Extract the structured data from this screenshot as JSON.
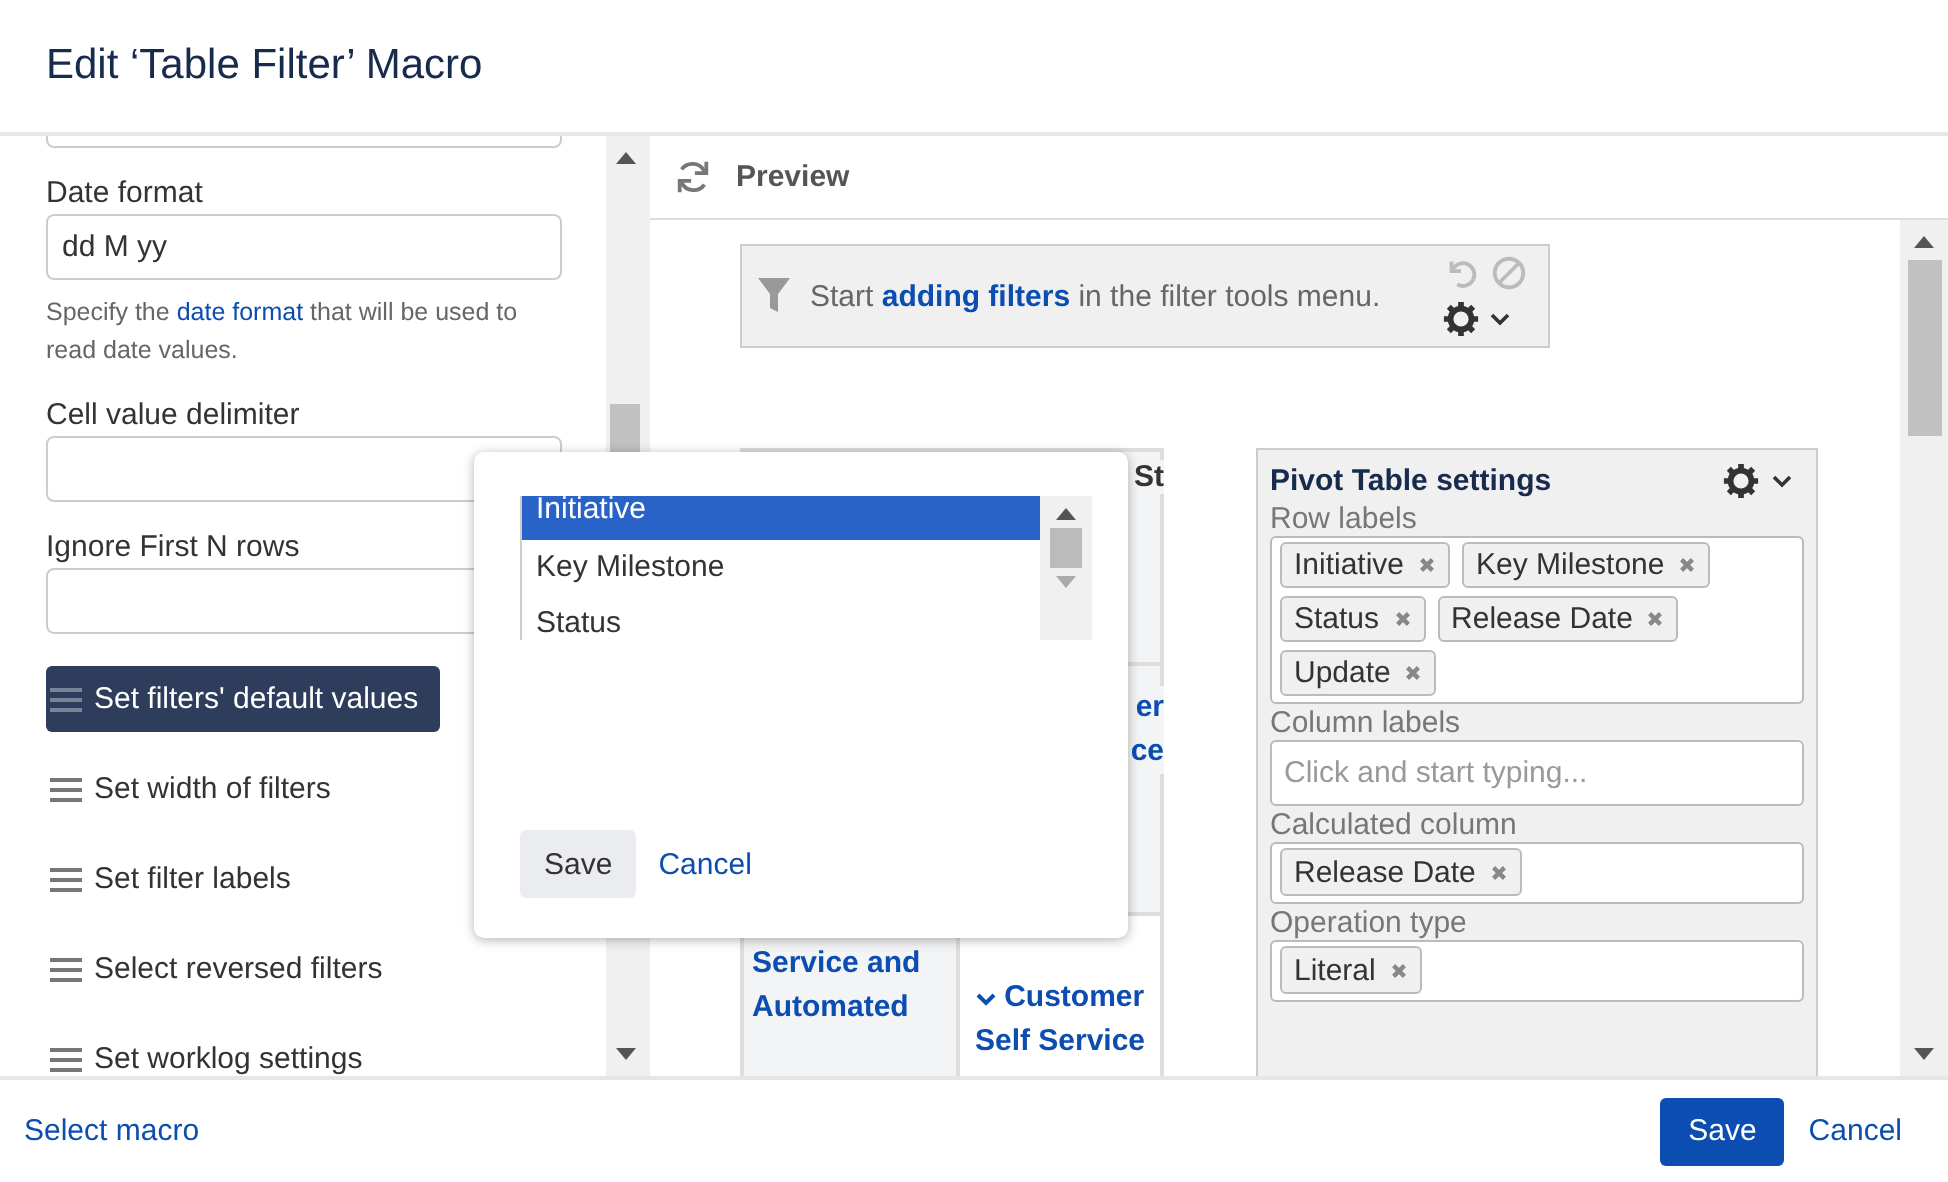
{
  "dialog": {
    "title": "Edit ‘Table Filter’ Macro"
  },
  "settings": {
    "fields": [
      {
        "label": "Date format",
        "value": "dd M yy",
        "help_before": "Specify the",
        "help_link": "date format",
        "help_after": "that will be used to read date values."
      },
      {
        "label": "Cell value delimiter"
      },
      {
        "label": "Ignore First N rows"
      }
    ],
    "menu": [
      {
        "label": "Set filters' default values",
        "selected": true
      },
      {
        "label": "Set width of filters",
        "selected": false
      },
      {
        "label": "Set filter labels",
        "selected": false
      },
      {
        "label": "Select reversed filters",
        "selected": false
      },
      {
        "label": "Set worklog settings",
        "selected": false
      }
    ]
  },
  "popup": {
    "options": [
      {
        "label": "Initiative",
        "selected": true
      },
      {
        "label": "Key Milestone",
        "selected": false
      },
      {
        "label": "Status",
        "selected": false
      }
    ],
    "save": "Save",
    "cancel": "Cancel"
  },
  "preview": {
    "title": "Preview",
    "filter_bar": {
      "text_before": "Start",
      "link": "adding filters",
      "text_after": "in the filter tools menu."
    },
    "table": {
      "header": "St",
      "row_1": [
        "er",
        "ce"
      ],
      "row_2": [
        "Service and Automated",
        "Customer Self Service"
      ]
    },
    "pivot": {
      "title": "Pivot Table settings",
      "sections": [
        {
          "label": "Row labels",
          "kind": "tags",
          "tags": [
            "Initiative",
            "Key Milestone",
            "Status",
            "Release Date",
            "Update"
          ]
        },
        {
          "label": "Column labels",
          "kind": "input",
          "placeholder": "Click and start typing..."
        },
        {
          "label": "Calculated column",
          "kind": "tags",
          "tags": [
            "Release Date"
          ]
        },
        {
          "label": "Operation type",
          "kind": "tags",
          "tags": [
            "Literal"
          ]
        }
      ]
    }
  },
  "footer": {
    "link": "Select macro",
    "save": "Save",
    "cancel": "Cancel"
  }
}
